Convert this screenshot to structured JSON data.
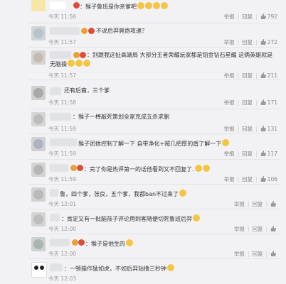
{
  "actions": {
    "report_label": "举报",
    "reply_label": "回复"
  },
  "comments": [
    {
      "text": "：猴子鲁班是你亲爹吧",
      "time": "今天 11:56",
      "likes": "792"
    },
    {
      "text": "不说后羿爽炮攻速？",
      "time": "今天 11:57",
      "likes": "272"
    },
    {
      "text": "：别跟我这扯高端局 大部分王者荣耀玩家都是铂金钻石星耀 这俩英雄就是无脑操",
      "time": "今天 11:57",
      "likes": "211"
    },
    {
      "text": "还有后裔，三个爹",
      "time": "今天 11:58",
      "likes": "171"
    },
    {
      "text": "：猴子一棒敲死策划全家克成五杀求删",
      "time": "今天 11:59",
      "likes": "131"
    },
    {
      "text": "猴子团体控制了解一下 自带净化+贼几把厚的盾了解一下",
      "time": "今天 11:59",
      "likes": "117"
    },
    {
      "text": "：完了你是热评第一的话他看到又不回复了.",
      "time": "今天 11:59",
      "likes": "106"
    },
    {
      "text": "鲁，四个爹，张良，五个爹，我都ban不过来了",
      "time": "今天 12:01",
      "likes": ""
    },
    {
      "text": "：肯定又有一批脑孩子评论用刺客随便切死鲁班后羿",
      "time": "今天 12:00",
      "likes": ""
    },
    {
      "text": "：猴子是他生的",
      "time": "今天 12:00",
      "likes": ""
    },
    {
      "text": "：一顿操作猛如虎，不如后羿站撸三秒钟",
      "time": "今天 12:03",
      "likes": ""
    }
  ]
}
